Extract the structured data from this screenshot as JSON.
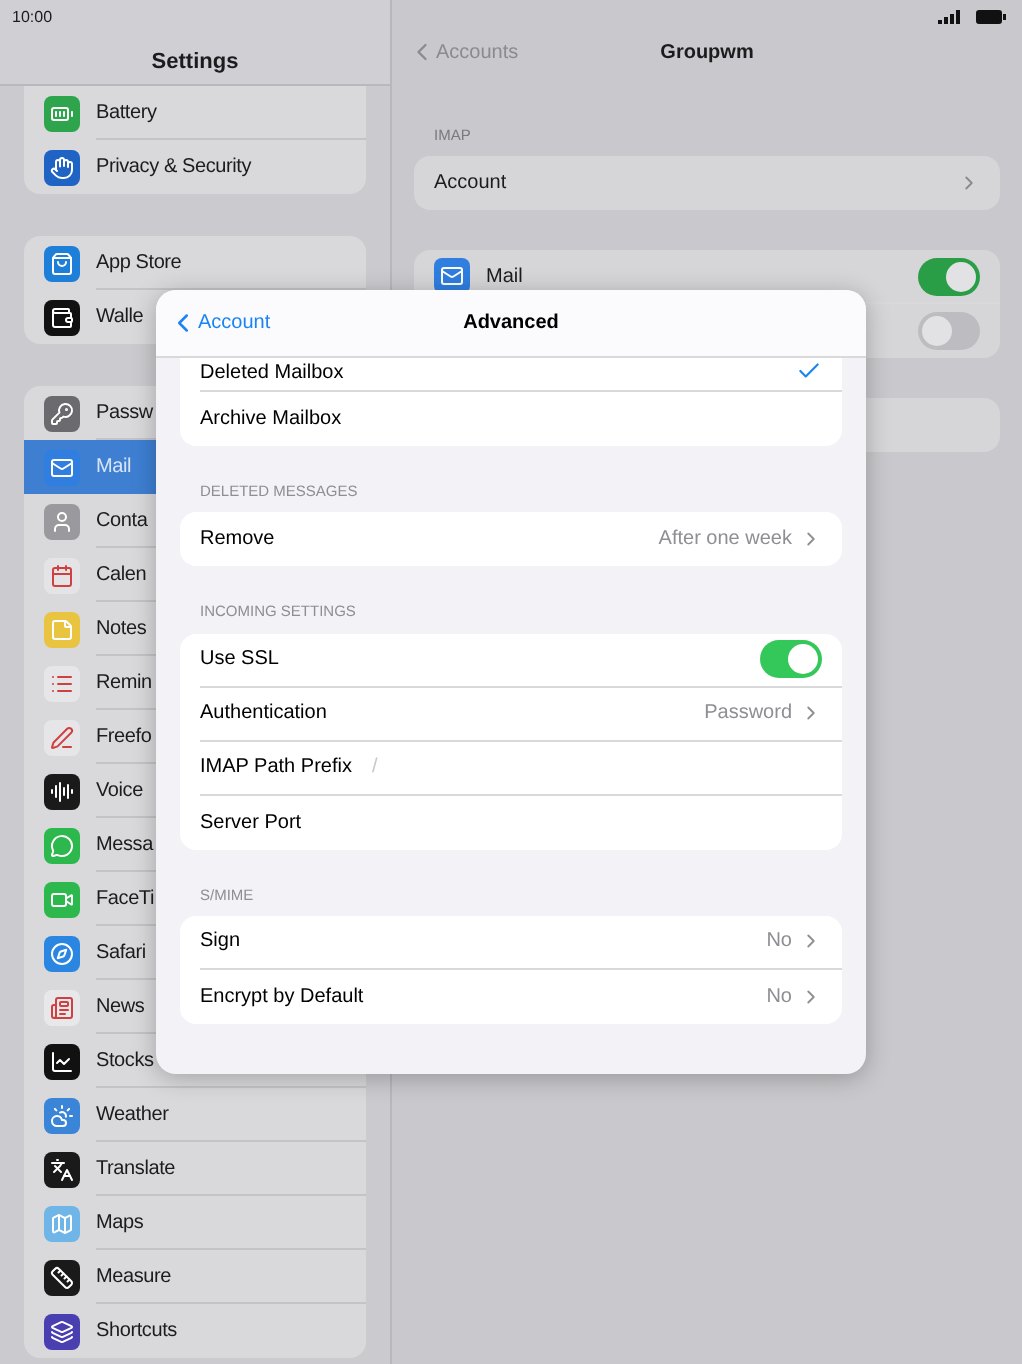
{
  "status_bar": {
    "time": "10:00"
  },
  "sidebar": {
    "title": "Settings",
    "groups": [
      {
        "items": [
          {
            "label": "Battery",
            "selected": false
          },
          {
            "label": "Privacy & Security",
            "selected": false
          }
        ]
      },
      {
        "items": [
          {
            "label": "App Store",
            "selected": false
          },
          {
            "label": "Walle",
            "selected": false
          }
        ]
      },
      {
        "items": [
          {
            "label": "Passw",
            "selected": false
          },
          {
            "label": "Mail",
            "selected": true
          },
          {
            "label": "Conta",
            "selected": false
          },
          {
            "label": "Calen",
            "selected": false
          },
          {
            "label": "Notes",
            "selected": false
          },
          {
            "label": "Remin",
            "selected": false
          },
          {
            "label": "Freefo",
            "selected": false
          },
          {
            "label": "Voice",
            "selected": false
          },
          {
            "label": "Messa",
            "selected": false
          },
          {
            "label": "FaceTi",
            "selected": false
          },
          {
            "label": "Safari",
            "selected": false
          },
          {
            "label": "News",
            "selected": false
          },
          {
            "label": "Stocks",
            "selected": false
          },
          {
            "label": "Weather",
            "selected": false
          },
          {
            "label": "Translate",
            "selected": false
          },
          {
            "label": "Maps",
            "selected": false
          },
          {
            "label": "Measure",
            "selected": false
          },
          {
            "label": "Shortcuts",
            "selected": false
          }
        ]
      }
    ]
  },
  "detail": {
    "back": "Accounts",
    "title": "Groupwm",
    "sections": [
      {
        "header": "IMAP",
        "rows": [
          {
            "kind": "link",
            "label": "Account"
          }
        ]
      },
      {
        "rows": [
          {
            "kind": "app_toggle",
            "label": "Mail",
            "on": true
          },
          {
            "kind": "toggle",
            "on": false
          }
        ]
      },
      {
        "rows": [
          {
            "kind": "blank"
          }
        ]
      }
    ]
  },
  "dialog": {
    "back": "Account",
    "title": "Advanced",
    "sections": [
      {
        "rows": [
          {
            "kind": "check",
            "label": "Deleted Mailbox",
            "selected": true
          },
          {
            "kind": "check",
            "label": "Archive Mailbox",
            "selected": false
          }
        ]
      },
      {
        "header": "DELETED MESSAGES",
        "rows": [
          {
            "kind": "link",
            "label": "Remove",
            "value": "After one week"
          }
        ]
      },
      {
        "header": "INCOMING SETTINGS",
        "rows": [
          {
            "kind": "toggle",
            "label": "Use SSL",
            "on": true
          },
          {
            "kind": "link",
            "label": "Authentication",
            "value": "Password"
          },
          {
            "kind": "field",
            "label": "IMAP Path Prefix",
            "value": "/"
          },
          {
            "kind": "field",
            "label": "Server Port"
          }
        ]
      },
      {
        "header": "S/MIME",
        "rows": [
          {
            "kind": "link",
            "label": "Sign",
            "value": "No"
          },
          {
            "kind": "link",
            "label": "Encrypt by Default",
            "value": "No"
          }
        ]
      }
    ]
  }
}
